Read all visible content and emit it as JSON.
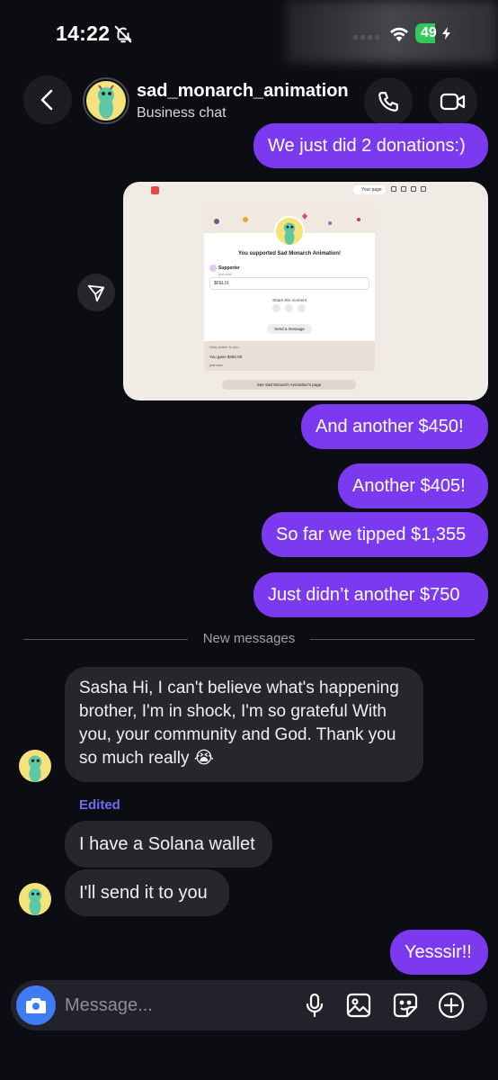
{
  "status_bar": {
    "time": "14:22",
    "battery": "49",
    "battery_level": 0.49
  },
  "header": {
    "name": "sad_monarch_animation",
    "subtitle": "Business chat"
  },
  "shared_card": {
    "your_page": "Your page",
    "title": "You supported Sad Monarch Animation!",
    "supporter": "Supporter",
    "just_now": "just now",
    "input_value": "$FELIX",
    "share_label": "Share this moment",
    "send_label": "Send a message",
    "note_visibility": "Only visible to you",
    "note_amount": "You gave $450.00",
    "note_time": "just now",
    "bottom_button": "See Sad Monarch Animation's page"
  },
  "messages": {
    "m1": "We just did 2 donations:)",
    "m2": "And another $450!",
    "m3": "Another $405!",
    "m4": "So far we tipped $1,355",
    "m5": "Just didn’t another $750",
    "divider": "New messages",
    "m6": "Sasha Hi, I can't believe what's happening brother, I'm in shock, I'm so grateful With you, your community and God. Thank you so much really 😭",
    "edited": "Edited",
    "m7": "I have a Solana wallet",
    "m8": "I'll send it to you",
    "m9": "Yesssir!!"
  },
  "composer": {
    "placeholder": "Message..."
  },
  "colors": {
    "outgoing": "#7b3af0",
    "incoming": "#26272c",
    "background": "#0c0d12",
    "accent": "#3f7bf5"
  }
}
